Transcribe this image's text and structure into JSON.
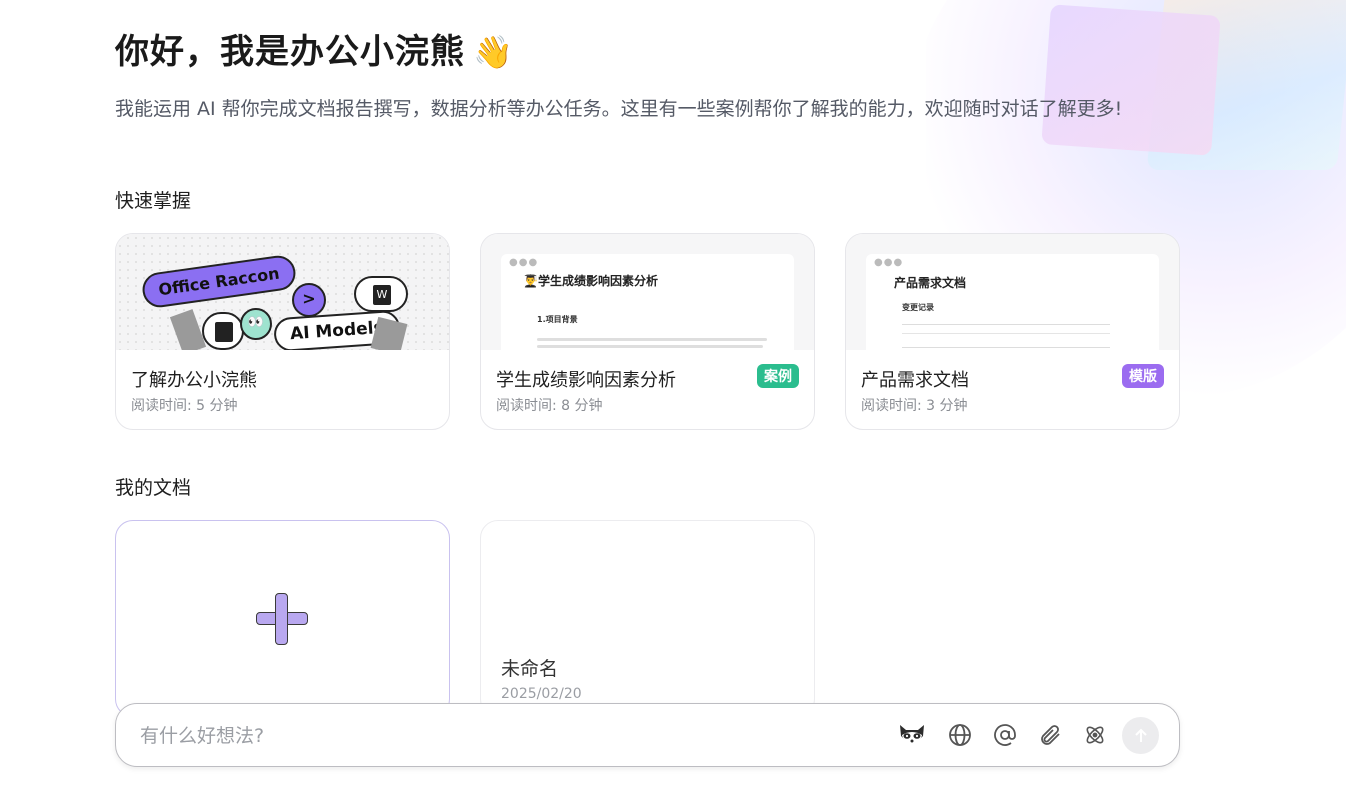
{
  "greeting": {
    "title": "你好，我是办公小浣熊",
    "emoji": "👋"
  },
  "intro": "我能运用 AI 帮你完成文档报告撰写，数据分析等办公任务。这里有一些案例帮你了解我的能力，欢迎随时对话了解更多!",
  "quick_start": {
    "title": "快速掌握",
    "cards": [
      {
        "title": "了解办公小浣熊",
        "read_time": "阅读时间: 5 分钟",
        "art_text_1": "Office Raccon",
        "art_text_2": "AI Models"
      },
      {
        "title": "学生成绩影响因素分析",
        "read_time": "阅读时间: 8 分钟",
        "badge": "案例",
        "badge_color": "#2bbd8e",
        "preview_heading": "👨‍🎓学生成绩影响因素分析",
        "preview_sub": "1.项目背景"
      },
      {
        "title": "产品需求文档",
        "read_time": "阅读时间: 3 分钟",
        "badge": "模版",
        "badge_color": "#9b6cf0",
        "preview_heading": "产品需求文档",
        "preview_sub": "变更记录"
      }
    ]
  },
  "my_docs": {
    "title": "我的文档",
    "items": [
      {
        "title": "未命名",
        "date": "2025/02/20"
      }
    ]
  },
  "chat": {
    "placeholder": "有什么好想法?",
    "tools": [
      "raccoon-icon",
      "globe-icon",
      "at-icon",
      "paperclip-icon",
      "atom-icon"
    ],
    "send_icon": "arrow-up-icon"
  }
}
